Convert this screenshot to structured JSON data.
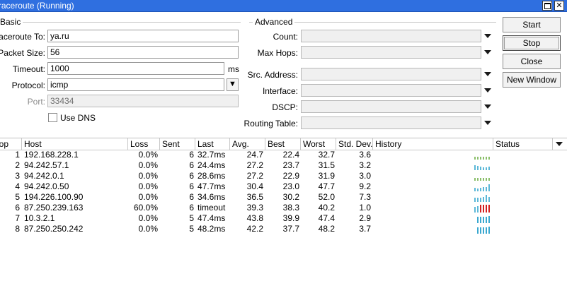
{
  "window": {
    "title": "Traceroute (Running)"
  },
  "basic": {
    "section_title": "Basic",
    "traceroute_to_label": "Traceroute To:",
    "traceroute_to_value": "ya.ru",
    "packet_size_label": "Packet Size:",
    "packet_size_value": "56",
    "timeout_label": "Timeout:",
    "timeout_value": "1000",
    "timeout_unit": "ms",
    "protocol_label": "Protocol:",
    "protocol_value": "icmp",
    "port_label": "Port:",
    "port_value": "33434",
    "use_dns_label": "Use DNS",
    "use_dns_checked": false
  },
  "advanced": {
    "section_title": "Advanced",
    "count_label": "Count:",
    "max_hops_label": "Max Hops:",
    "src_address_label": "Src. Address:",
    "interface_label": "Interface:",
    "dscp_label": "DSCP:",
    "routing_table_label": "Routing Table:"
  },
  "buttons": {
    "start": "Start",
    "stop": "Stop",
    "close": "Close",
    "new_window": "New Window"
  },
  "table": {
    "headers": [
      "Hop",
      "Host",
      "Loss",
      "Sent",
      "Last",
      "Avg.",
      "Best",
      "Worst",
      "Std. Dev.",
      "History",
      "Status"
    ],
    "rows": [
      {
        "hop": "1",
        "host": "192.168.228.1",
        "loss": "0.0%",
        "sent": "6",
        "last": "32.7ms",
        "avg": "24.7",
        "best": "22.4",
        "worst": "32.7",
        "stddev": "3.6",
        "status": "",
        "history": {
          "color": "#8bbf6a",
          "levels": [
            0.35,
            0.35,
            0.35,
            0.35,
            0.35,
            0.35
          ]
        }
      },
      {
        "hop": "2",
        "host": "94.242.57.1",
        "loss": "0.0%",
        "sent": "6",
        "last": "24.4ms",
        "avg": "27.2",
        "best": "23.7",
        "worst": "31.5",
        "stddev": "3.2",
        "status": "",
        "history": {
          "color": "#5cb8d8",
          "levels": [
            0.6,
            0.5,
            0.45,
            0.4,
            0.4,
            0.45
          ]
        }
      },
      {
        "hop": "3",
        "host": "94.242.0.1",
        "loss": "0.0%",
        "sent": "6",
        "last": "28.6ms",
        "avg": "27.2",
        "best": "22.9",
        "worst": "31.9",
        "stddev": "3.0",
        "status": "",
        "history": {
          "color": "#8bbf6a",
          "levels": [
            0.35,
            0.35,
            0.35,
            0.35,
            0.35,
            0.35
          ]
        }
      },
      {
        "hop": "4",
        "host": "94.242.0.50",
        "loss": "0.0%",
        "sent": "6",
        "last": "47.7ms",
        "avg": "30.4",
        "best": "23.0",
        "worst": "47.7",
        "stddev": "9.2",
        "status": "",
        "history": {
          "color": "#5cb8d8",
          "levels": [
            0.45,
            0.4,
            0.45,
            0.5,
            0.55,
            0.9
          ]
        }
      },
      {
        "hop": "5",
        "host": "194.226.100.90",
        "loss": "0.0%",
        "sent": "6",
        "last": "34.6ms",
        "avg": "36.5",
        "best": "30.2",
        "worst": "52.0",
        "stddev": "7.3",
        "status": "",
        "history": {
          "color": "#5cb8d8",
          "levels": [
            0.5,
            0.55,
            0.5,
            0.6,
            0.95,
            0.6
          ]
        }
      },
      {
        "hop": "6",
        "host": "87.250.239.163",
        "loss": "60.0%",
        "sent": "6",
        "last": "timeout",
        "avg": "39.3",
        "best": "38.3",
        "worst": "40.2",
        "stddev": "1.0",
        "status": "",
        "history": {
          "color": "#5cb8d8",
          "alert_color": "#d42020",
          "levels": [
            0.7,
            0.8,
            1,
            1,
            1,
            1
          ],
          "timeouts": [
            false,
            false,
            true,
            true,
            true,
            true
          ]
        }
      },
      {
        "hop": "7",
        "host": "10.3.2.1",
        "loss": "0.0%",
        "sent": "5",
        "last": "47.4ms",
        "avg": "43.8",
        "best": "39.9",
        "worst": "47.4",
        "stddev": "2.9",
        "status": "",
        "history": {
          "color": "#3aa8d0",
          "levels": [
            0.85,
            0.85,
            0.85,
            0.85,
            0.9
          ]
        }
      },
      {
        "hop": "8",
        "host": "87.250.250.242",
        "loss": "0.0%",
        "sent": "5",
        "last": "48.2ms",
        "avg": "42.2",
        "best": "37.7",
        "worst": "48.2",
        "stddev": "3.7",
        "status": "",
        "history": {
          "color": "#3aa8d0",
          "levels": [
            0.85,
            0.85,
            0.85,
            0.85,
            0.9
          ]
        }
      }
    ]
  }
}
